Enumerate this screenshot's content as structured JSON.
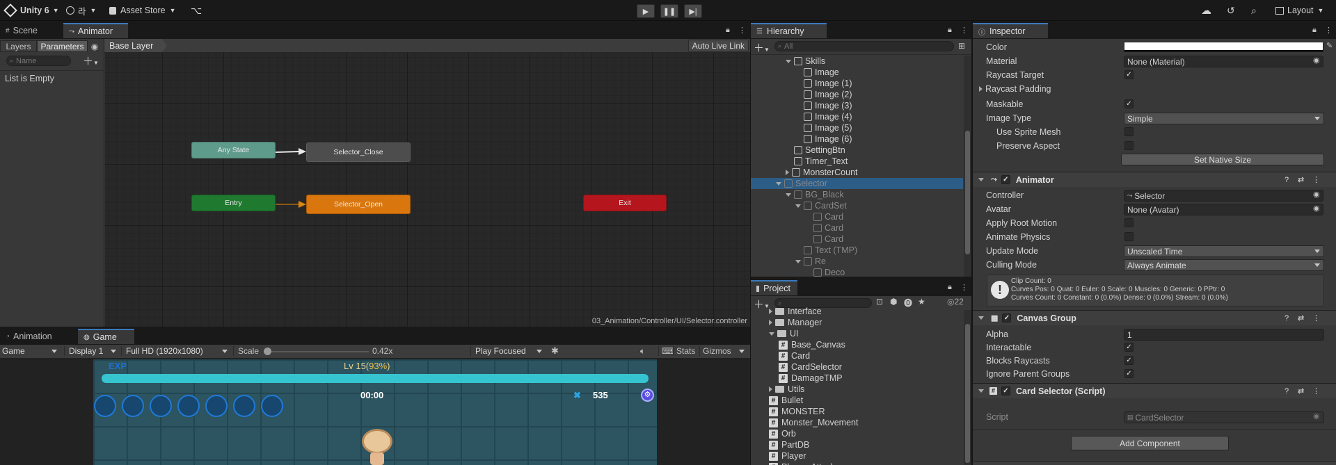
{
  "topbar": {
    "app_title": "Unity 6",
    "account_label": "라",
    "asset_store_label": "Asset Store",
    "layout_label": "Layout"
  },
  "scene_panel": {
    "tabs": [
      "Scene",
      "Animator"
    ],
    "layers_tab": "Layers",
    "parameters_tab": "Parameters",
    "breadcrumb": "Base Layer",
    "auto_live_link": "Auto Live Link",
    "search_placeholder": "Name",
    "list_empty": "List is Empty",
    "footer_path": "03_Animation/Controller/UI/Selector.controller",
    "nodes": {
      "any_state": "Any State",
      "entry": "Entry",
      "selector_close": "Selector_Close",
      "selector_open": "Selector_Open",
      "exit": "Exit"
    }
  },
  "game_panel": {
    "tabs": [
      "Animation",
      "Game"
    ],
    "mode": "Game",
    "display": "Display 1",
    "resolution": "Full HD (1920x1080)",
    "scale_label": "Scale",
    "scale_value": "0.42x",
    "play_focused": "Play Focused",
    "stats": "Stats",
    "gizmos": "Gizmos",
    "hud": {
      "exp": "EXP",
      "level": "Lv 15(",
      "level_pct": "93%",
      "level_end": ")",
      "timer": "00:00",
      "kills": "535",
      "exp_fill": 1.0
    }
  },
  "hierarchy": {
    "title": "Hierarchy",
    "search_placeholder": "All",
    "items": [
      {
        "label": "Skills",
        "depth": 5,
        "expanded": true,
        "dim": false
      },
      {
        "label": "Image",
        "depth": 6,
        "dim": false
      },
      {
        "label": "Image (1)",
        "depth": 6,
        "dim": false
      },
      {
        "label": "Image (2)",
        "depth": 6,
        "dim": false
      },
      {
        "label": "Image (3)",
        "depth": 6,
        "dim": false
      },
      {
        "label": "Image (4)",
        "depth": 6,
        "dim": false
      },
      {
        "label": "Image (5)",
        "depth": 6,
        "dim": false
      },
      {
        "label": "Image (6)",
        "depth": 6,
        "dim": false
      },
      {
        "label": "SettingBtn",
        "depth": 5,
        "dim": false
      },
      {
        "label": "Timer_Text",
        "depth": 5,
        "dim": false
      },
      {
        "label": "MonsterCount",
        "depth": 5,
        "collapsed": true,
        "dim": false
      },
      {
        "label": "Selector",
        "depth": 4,
        "expanded": true,
        "selected": true,
        "dim": true
      },
      {
        "label": "BG_Black",
        "depth": 5,
        "expanded": true,
        "dim": true
      },
      {
        "label": "CardSet",
        "depth": 6,
        "expanded": true,
        "dim": true
      },
      {
        "label": "Card",
        "depth": 7,
        "dim": true
      },
      {
        "label": "Card",
        "depth": 7,
        "dim": true
      },
      {
        "label": "Card",
        "depth": 7,
        "dim": true
      },
      {
        "label": "Text (TMP)",
        "depth": 6,
        "dim": true
      },
      {
        "label": "Re",
        "depth": 6,
        "expanded": true,
        "dim": true
      },
      {
        "label": "Deco",
        "depth": 7,
        "dim": true
      }
    ]
  },
  "project": {
    "title": "Project",
    "hidden_count": "22",
    "items": [
      {
        "label": "Interface",
        "type": "folder",
        "depth": 2,
        "collapsed": true
      },
      {
        "label": "Manager",
        "type": "folder",
        "depth": 2,
        "collapsed": true
      },
      {
        "label": "UI",
        "type": "folder",
        "depth": 2,
        "expanded": true
      },
      {
        "label": "Base_Canvas",
        "type": "script",
        "depth": 3
      },
      {
        "label": "Card",
        "type": "script",
        "depth": 3
      },
      {
        "label": "CardSelector",
        "type": "script",
        "depth": 3
      },
      {
        "label": "DamageTMP",
        "type": "script",
        "depth": 3
      },
      {
        "label": "Utils",
        "type": "folder",
        "depth": 2,
        "collapsed": true
      },
      {
        "label": "Bullet",
        "type": "script",
        "depth": 2
      },
      {
        "label": "MONSTER",
        "type": "script",
        "depth": 2
      },
      {
        "label": "Monster_Movement",
        "type": "script",
        "depth": 2
      },
      {
        "label": "Orb",
        "type": "script",
        "depth": 2
      },
      {
        "label": "PartDB",
        "type": "script",
        "depth": 2
      },
      {
        "label": "Player",
        "type": "script",
        "depth": 2
      },
      {
        "label": "Player_Attacker",
        "type": "script",
        "depth": 2
      }
    ]
  },
  "inspector": {
    "title": "Inspector",
    "image_props": {
      "color": "Color",
      "material": "Material",
      "material_value": "None (Material)",
      "raycast_target": "Raycast Target",
      "raycast_padding": "Raycast Padding",
      "maskable": "Maskable",
      "image_type": "Image Type",
      "image_type_value": "Simple",
      "use_sprite_mesh": "Use Sprite Mesh",
      "preserve_aspect": "Preserve Aspect",
      "set_native_size": "Set Native Size"
    },
    "animator": {
      "title": "Animator",
      "controller": "Controller",
      "controller_value": "Selector",
      "avatar": "Avatar",
      "avatar_value": "None (Avatar)",
      "apply_root_motion": "Apply Root Motion",
      "animate_physics": "Animate Physics",
      "update_mode": "Update Mode",
      "update_mode_value": "Unscaled Time",
      "culling_mode": "Culling Mode",
      "culling_mode_value": "Always Animate",
      "info_line1": "Clip Count: 0",
      "info_line2": "Curves Pos: 0 Quat: 0 Euler: 0 Scale: 0 Muscles: 0 Generic: 0 PPtr: 0",
      "info_line3": "Curves Count: 0 Constant: 0 (0.0%) Dense: 0 (0.0%) Stream: 0 (0.0%)"
    },
    "canvas_group": {
      "title": "Canvas Group",
      "alpha": "Alpha",
      "alpha_value": "1",
      "interactable": "Interactable",
      "blocks_raycasts": "Blocks Raycasts",
      "ignore_parent_groups": "Ignore Parent Groups"
    },
    "card_selector": {
      "title": "Card Selector (Script)",
      "script": "Script",
      "script_value": "CardSelector"
    },
    "add_component": "Add Component"
  },
  "colors": {
    "accent": "#3a79bb",
    "selection": "#2c5d87",
    "any_state": "#5f9b8b",
    "entry": "#1f7a2f",
    "open": "#d9770e",
    "exit": "#b5161d",
    "close": "#4d4d4d",
    "exp_bar": "#35c4d0"
  }
}
